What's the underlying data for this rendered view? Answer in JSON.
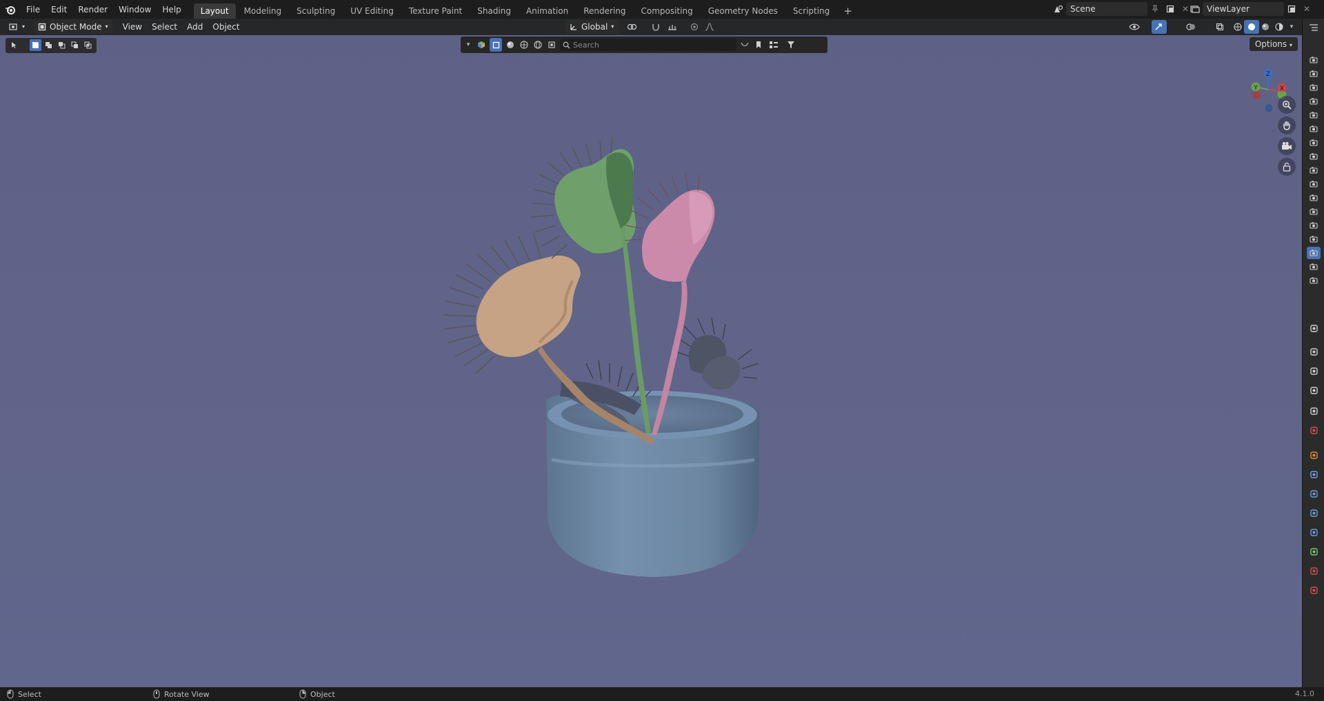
{
  "menu": {
    "items": [
      "File",
      "Edit",
      "Render",
      "Window",
      "Help"
    ]
  },
  "workspaces": {
    "tabs": [
      "Layout",
      "Modeling",
      "Sculpting",
      "UV Editing",
      "Texture Paint",
      "Shading",
      "Animation",
      "Rendering",
      "Compositing",
      "Geometry Nodes",
      "Scripting"
    ],
    "active": "Layout",
    "add_icon": "plus-icon"
  },
  "scene": {
    "name": "Scene",
    "view_layer": "ViewLayer"
  },
  "viewport_header": {
    "mode": "Object Mode",
    "menus": [
      "View",
      "Select",
      "Add",
      "Object"
    ],
    "orientation": "Global",
    "options_label": "Options"
  },
  "filter_bar": {
    "search_placeholder": "Search"
  },
  "gizmo": {
    "x_label": "X",
    "y_label": "Y",
    "z_label": "Z"
  },
  "statusbar": {
    "left": "Select",
    "middle": "Rotate View",
    "right": "Object",
    "version": "4.1.0"
  },
  "colors": {
    "background_top": "#5e6186",
    "pot": "#6f8aa6",
    "trap_green": "#6e9e6a",
    "trap_pink": "#c98aa8",
    "trap_tan": "#c7a283",
    "trap_dark": "#4e5560",
    "accent_blue": "#4772b3"
  }
}
